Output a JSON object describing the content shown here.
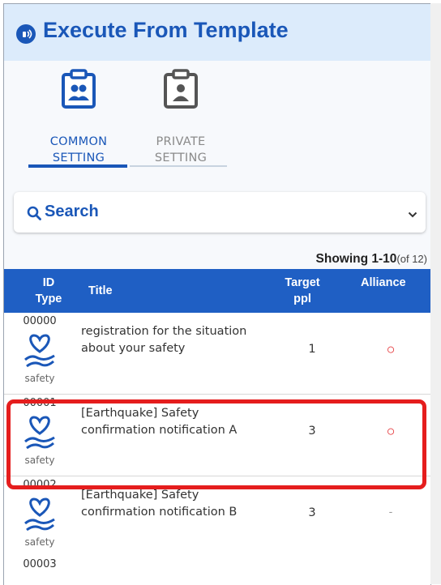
{
  "header": {
    "title": "Execute From Template",
    "icon": "broadcast-icon"
  },
  "tabs": [
    {
      "label": "COMMON SETTING",
      "icon": "clipboard-group-icon",
      "active": true
    },
    {
      "label": "PRIVATE SETTING",
      "icon": "clipboard-person-icon",
      "active": false
    }
  ],
  "search": {
    "label": "Search",
    "icon": "search-icon",
    "toggle_icon": "chevron-down-icon"
  },
  "showing": {
    "range": "Showing 1-10",
    "total": "(of 12)"
  },
  "table": {
    "headers": {
      "id_type": "ID Type",
      "title": "Title",
      "target": "Target ppl",
      "alliance": "Alliance"
    },
    "rows": [
      {
        "id": "00000",
        "type": "safety",
        "title": "registration for the situation about your safety",
        "target": "1",
        "alliance": "○"
      },
      {
        "id": "00001",
        "type": "safety",
        "title": "[Earthquake] Safety confirmation notification A",
        "target": "3",
        "alliance": "○"
      },
      {
        "id": "00002",
        "type": "safety",
        "title": "[Earthquake] Safety confirmation notification B",
        "target": "3",
        "alliance": "-"
      },
      {
        "id": "00003"
      }
    ]
  },
  "colors": {
    "accent": "#1a57b8",
    "header_bg": "#dcebfb",
    "table_header": "#1f5fc4",
    "highlight": "#e51d1d",
    "alliance_yes": "#e3262a"
  }
}
